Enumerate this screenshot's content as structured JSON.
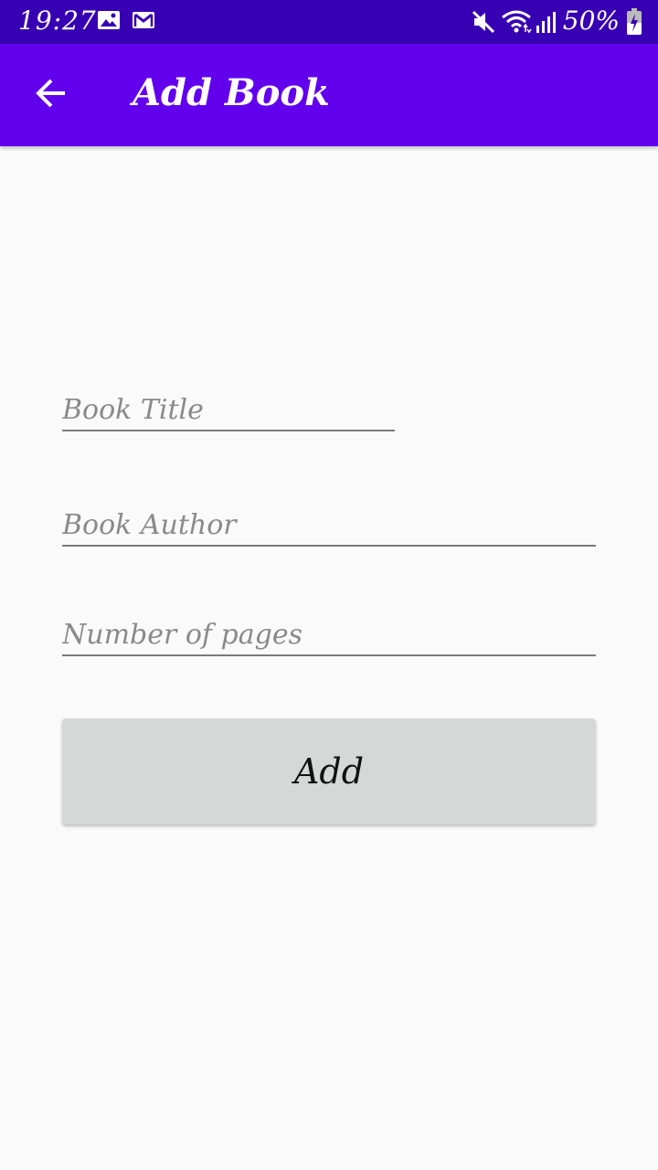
{
  "status_bar": {
    "time": "19:27",
    "battery": "50%",
    "icons": [
      "image-icon",
      "gmail-icon",
      "mute-icon",
      "wifi-icon",
      "signal-icon",
      "battery-charging-icon"
    ]
  },
  "app_bar": {
    "title": "Add Book",
    "back_icon": "arrow-back-icon"
  },
  "form": {
    "title_placeholder": "Book Title",
    "title_value": "",
    "author_placeholder": "Book Author",
    "author_value": "",
    "pages_placeholder": "Number of pages",
    "pages_value": "",
    "add_label": "Add"
  },
  "colors": {
    "status_bar": "#3700b3",
    "app_bar": "#6200ee",
    "background": "#fafafa",
    "button": "#d6d7d7"
  }
}
